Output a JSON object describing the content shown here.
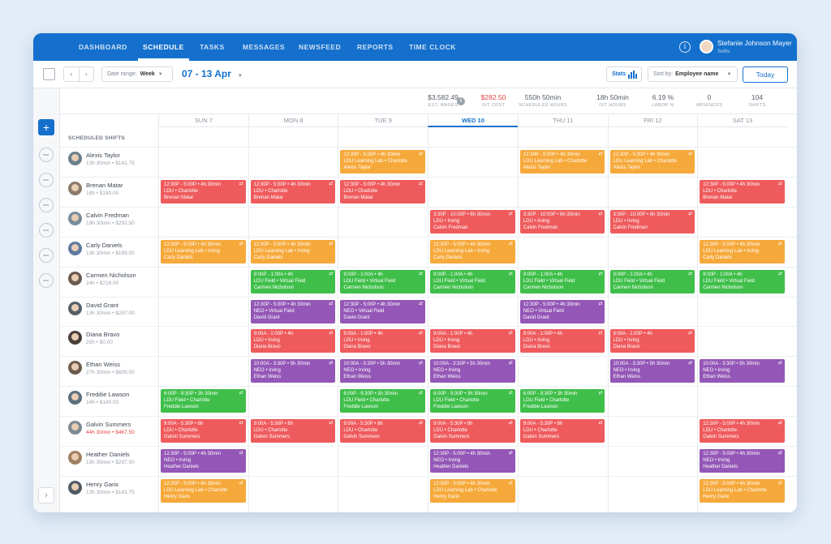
{
  "nav": {
    "tabs": [
      "DASHBOARD",
      "SCHEDULE",
      "TASKS",
      "MESSAGES",
      "NEWSFEED",
      "REPORTS",
      "TIME CLOCK"
    ],
    "active": "SCHEDULE",
    "user_name": "Stefanie Johnson Mayer",
    "user_sub": "Sellis"
  },
  "toolbar": {
    "date_range_label": "Date range:",
    "date_range_value": "Week",
    "week_title": "07 - 13 Apr",
    "stats_label": "Stats",
    "sort_label": "Sort by:",
    "sort_value": "Employee name",
    "today_label": "Today",
    "prev": "‹",
    "next": "›"
  },
  "stats": [
    {
      "value": "$3,582.49",
      "label": "EST. WAGES",
      "color": "#555e68"
    },
    {
      "value": "$282.50",
      "label": "O/T COST",
      "color": "#e2433e"
    },
    {
      "value": "550h 50min",
      "label": "SCHEDULED HOURS",
      "color": "#555e68"
    },
    {
      "value": "18h 50min",
      "label": "O/T HOURS",
      "color": "#555e68"
    },
    {
      "value": "6.19 %",
      "label": "LABOR %",
      "color": "#555e68"
    },
    {
      "value": "0",
      "label": "ABSENCES",
      "color": "#555e68"
    },
    {
      "value": "104",
      "label": "SHIFTS",
      "color": "#555e68"
    }
  ],
  "days": [
    "SUN 7",
    "MON 8",
    "TUE 9",
    "WED 10",
    "THU 11",
    "FRI 12",
    "SAT 13"
  ],
  "today_index": 3,
  "section_title": "SCHEDULED SHIFTS",
  "employees": [
    {
      "name": "Alexis Taylor",
      "meta": "13h 30min • $141.75",
      "over": false,
      "avatar": "#6b7f8c",
      "shifts": [
        {
          "day": 2,
          "c": "orange",
          "t": "12:30P - 5:00P • 4h 30min",
          "l": "LDU Learning Lab • Charlotte",
          "n": "Alexis Taylor"
        },
        {
          "day": 4,
          "c": "orange",
          "t": "12:30P - 5:00P • 4h 30min",
          "l": "LDU Learning Lab • Charlotte",
          "n": "Alexis Taylor"
        },
        {
          "day": 5,
          "c": "orange",
          "t": "12:30P - 5:00P • 4h 30min",
          "l": "LDU Learning Lab • Charlotte",
          "n": "Alexis Taylor"
        }
      ]
    },
    {
      "name": "Brenan Matar",
      "meta": "18h • $180.00",
      "over": false,
      "avatar": "#8c7a6b",
      "shifts": [
        {
          "day": 0,
          "c": "red",
          "t": "12:30P - 5:00P • 4h 30min",
          "l": "LDU • Charlotte",
          "n": "Brenan Matar"
        },
        {
          "day": 1,
          "c": "red",
          "t": "12:30P - 5:00P • 4h 30min",
          "l": "LDU • Charlotte",
          "n": "Brenan Matar"
        },
        {
          "day": 2,
          "c": "red",
          "t": "12:30P - 5:00P • 4h 30min",
          "l": "LDU • Charlotte",
          "n": "Brenan Matar"
        },
        {
          "day": 6,
          "c": "red",
          "t": "12:30P - 5:00P • 4h 30min",
          "l": "LDU • Charlotte",
          "n": "Brenan Matar"
        }
      ]
    },
    {
      "name": "Calvin Fredman",
      "meta": "19h 30min • $292.50",
      "over": false,
      "avatar": "#7a8c9a",
      "shifts": [
        {
          "day": 3,
          "c": "red",
          "t": "3:30P - 10:00P • 6h 30min",
          "l": "LDU • Irving",
          "n": "Calvin Fredman"
        },
        {
          "day": 4,
          "c": "red",
          "t": "3:30P - 10:00P • 6h 30min",
          "l": "LDU • Irving",
          "n": "Calvin Fredman"
        },
        {
          "day": 5,
          "c": "red",
          "t": "3:30P - 10:00P • 6h 30min",
          "l": "LDU • Irving",
          "n": "Calvin Fredman"
        }
      ]
    },
    {
      "name": "Carly Daniels",
      "meta": "13h 30min • $189.00",
      "over": false,
      "avatar": "#5f7aa0",
      "shifts": [
        {
          "day": 0,
          "c": "orange",
          "t": "12:30P - 5:00P • 4h 30min",
          "l": "LDU Learning Lab • Irving",
          "n": "Carly Daniels"
        },
        {
          "day": 1,
          "c": "orange",
          "t": "12:30P - 5:00P • 4h 30min",
          "l": "LDU Learning Lab • Irving",
          "n": "Carly Daniels"
        },
        {
          "day": 3,
          "c": "orange",
          "t": "12:30P - 5:00P • 4h 30min",
          "l": "LDU Learning Lab • Irving",
          "n": "Carly Daniels"
        },
        {
          "day": 6,
          "c": "orange",
          "t": "12:30P - 5:00P • 4h 30min",
          "l": "LDU Learning Lab • Irving",
          "n": "Carly Daniels"
        }
      ]
    },
    {
      "name": "Carmen Nicholson",
      "meta": "24h • $216.00",
      "over": false,
      "avatar": "#6a5a50",
      "shifts": [
        {
          "day": 1,
          "c": "green",
          "t": "9:00P - 1:00A • 4h",
          "l": "LDU Field • Virtual Field",
          "n": "Carmen Nicholson"
        },
        {
          "day": 2,
          "c": "green",
          "t": "9:00P - 1:00A • 4h",
          "l": "LDU Field • Virtual Field",
          "n": "Carmen Nicholson"
        },
        {
          "day": 3,
          "c": "green",
          "t": "9:00P - 1:00A • 4h",
          "l": "LDU Field • Virtual Field",
          "n": "Carmen Nicholson"
        },
        {
          "day": 4,
          "c": "green",
          "t": "9:00P - 1:00A • 4h",
          "l": "LDU Field • Virtual Field",
          "n": "Carmen Nicholson"
        },
        {
          "day": 5,
          "c": "green",
          "t": "9:00P - 1:00A • 4h",
          "l": "LDU Field • Virtual Field",
          "n": "Carmen Nicholson"
        },
        {
          "day": 6,
          "c": "green",
          "t": "9:00P - 1:00A • 4h",
          "l": "LDU Field • Virtual Field",
          "n": "Carmen Nicholson"
        }
      ]
    },
    {
      "name": "David Grant",
      "meta": "13h 30min • $297.00",
      "over": false,
      "avatar": "#55606a",
      "shifts": [
        {
          "day": 1,
          "c": "purple",
          "t": "12:30P - 5:00P • 4h 30min",
          "l": "NEO • Virtual Field",
          "n": "David Grant"
        },
        {
          "day": 2,
          "c": "purple",
          "t": "12:30P - 5:00P • 4h 30min",
          "l": "NEO • Virtual Field",
          "n": "David Grant"
        },
        {
          "day": 4,
          "c": "purple",
          "t": "12:30P - 5:00P • 4h 30min",
          "l": "NEO • Virtual Field",
          "n": "David Grant"
        }
      ]
    },
    {
      "name": "Diana Bravo",
      "meta": "20h • $0.00",
      "over": false,
      "avatar": "#4b3f3a",
      "shifts": [
        {
          "day": 1,
          "c": "red",
          "t": "9:00A - 1:00P • 4h",
          "l": "LDU • Irving",
          "n": "Diana Bravo"
        },
        {
          "day": 2,
          "c": "red",
          "t": "9:00A - 1:00P • 4h",
          "l": "LDU • Irving",
          "n": "Diana Bravo"
        },
        {
          "day": 3,
          "c": "red",
          "t": "9:00A - 1:00P • 4h",
          "l": "LDU • Irving",
          "n": "Diana Bravo"
        },
        {
          "day": 4,
          "c": "red",
          "t": "9:00A - 1:00P • 4h",
          "l": "LDU • Irving",
          "n": "Diana Bravo"
        },
        {
          "day": 5,
          "c": "red",
          "t": "9:00A - 1:00P • 4h",
          "l": "LDU • Irving",
          "n": "Diana Bravo"
        }
      ]
    },
    {
      "name": "Ethan Weiss",
      "meta": "27h 30min • $605.00",
      "over": false,
      "avatar": "#6e5c4c",
      "shifts": [
        {
          "day": 1,
          "c": "purple",
          "t": "10:00A - 3:30P • 5h 30min",
          "l": "NEO • Irving",
          "n": "Ethan Weiss"
        },
        {
          "day": 2,
          "c": "purple",
          "t": "10:00A - 3:30P • 5h 30min",
          "l": "NEO • Irving",
          "n": "Ethan Weiss"
        },
        {
          "day": 3,
          "c": "purple",
          "t": "10:00A - 3:30P • 5h 30min",
          "l": "NEO • Irving",
          "n": "Ethan Weiss"
        },
        {
          "day": 5,
          "c": "purple",
          "t": "10:00A - 3:30P • 5h 30min",
          "l": "NEO • Irving",
          "n": "Ethan Weiss"
        },
        {
          "day": 6,
          "c": "purple",
          "t": "10:00A - 3:30P • 5h 30min",
          "l": "NEO • Irving",
          "n": "Ethan Weiss"
        }
      ]
    },
    {
      "name": "Freddie Lawson",
      "meta": "14h • $140.00",
      "over": false,
      "avatar": "#5c6f7c",
      "shifts": [
        {
          "day": 0,
          "c": "green",
          "t": "6:00P - 9:30P • 3h 30min",
          "l": "LDU Field • Charlotte",
          "n": "Freddie Lawson"
        },
        {
          "day": 2,
          "c": "green",
          "t": "6:00P - 9:30P • 3h 30min",
          "l": "LDU Field • Charlotte",
          "n": "Freddie Lawson"
        },
        {
          "day": 3,
          "c": "green",
          "t": "6:00P - 9:30P • 3h 30min",
          "l": "LDU Field • Charlotte",
          "n": "Freddie Lawson"
        },
        {
          "day": 4,
          "c": "green",
          "t": "6:00P - 9:30P • 3h 30min",
          "l": "LDU Field • Charlotte",
          "n": "Freddie Lawson"
        }
      ]
    },
    {
      "name": "Galvin Summers",
      "meta": "44h 30min • $467.50",
      "over": true,
      "avatar": "#7d8a94",
      "shifts": [
        {
          "day": 0,
          "c": "red",
          "t": "9:00A - 5:30P • 8h",
          "l": "LDU • Charlotte",
          "n": "Galvin Summers"
        },
        {
          "day": 1,
          "c": "red",
          "t": "9:00A - 5:30P • 8h",
          "l": "LDU • Charlotte",
          "n": "Galvin Summers"
        },
        {
          "day": 2,
          "c": "red",
          "t": "9:00A - 5:30P • 8h",
          "l": "LDU • Charlotte",
          "n": "Galvin Summers"
        },
        {
          "day": 3,
          "c": "red",
          "t": "9:00A - 5:30P • 8h",
          "l": "LDU • Charlotte",
          "n": "Galvin Summers"
        },
        {
          "day": 4,
          "c": "red",
          "t": "9:00A - 5:30P • 8h",
          "l": "LDU • Charlotte",
          "n": "Galvin Summers"
        },
        {
          "day": 6,
          "c": "red",
          "t": "12:30P - 5:00P • 4h 30min",
          "l": "LDU • Charlotte",
          "n": "Galvin Summers"
        }
      ]
    },
    {
      "name": "Heather Daniels",
      "meta": "13h 30min • $297.00",
      "over": false,
      "avatar": "#a08060",
      "shifts": [
        {
          "day": 0,
          "c": "purple",
          "t": "12:30P - 5:00P • 4h 30min",
          "l": "NEO • Irving",
          "n": "Heather Daniels"
        },
        {
          "day": 3,
          "c": "purple",
          "t": "12:30P - 5:00P • 4h 30min",
          "l": "NEO • Irving",
          "n": "Heather Daniels"
        },
        {
          "day": 6,
          "c": "purple",
          "t": "12:30P - 5:00P • 4h 30min",
          "l": "NEO • Irving",
          "n": "Heather Daniels"
        }
      ]
    },
    {
      "name": "Henry Garix",
      "meta": "13h 30min • $141.75",
      "over": false,
      "avatar": "#4f5a63",
      "shifts": [
        {
          "day": 0,
          "c": "orange",
          "t": "12:30P - 5:00P • 4h 30min",
          "l": "LDU Learning Lab • Charlotte",
          "n": "Henry Garix"
        },
        {
          "day": 3,
          "c": "orange",
          "t": "12:30P - 5:00P • 4h 30min",
          "l": "LDU Learning Lab • Charlotte",
          "n": "Henry Garix"
        },
        {
          "day": 6,
          "c": "orange",
          "t": "12:30P - 5:00P • 4h 30min",
          "l": "LDU Learning Lab • Charlotte",
          "n": "Henry Garix"
        }
      ]
    }
  ]
}
